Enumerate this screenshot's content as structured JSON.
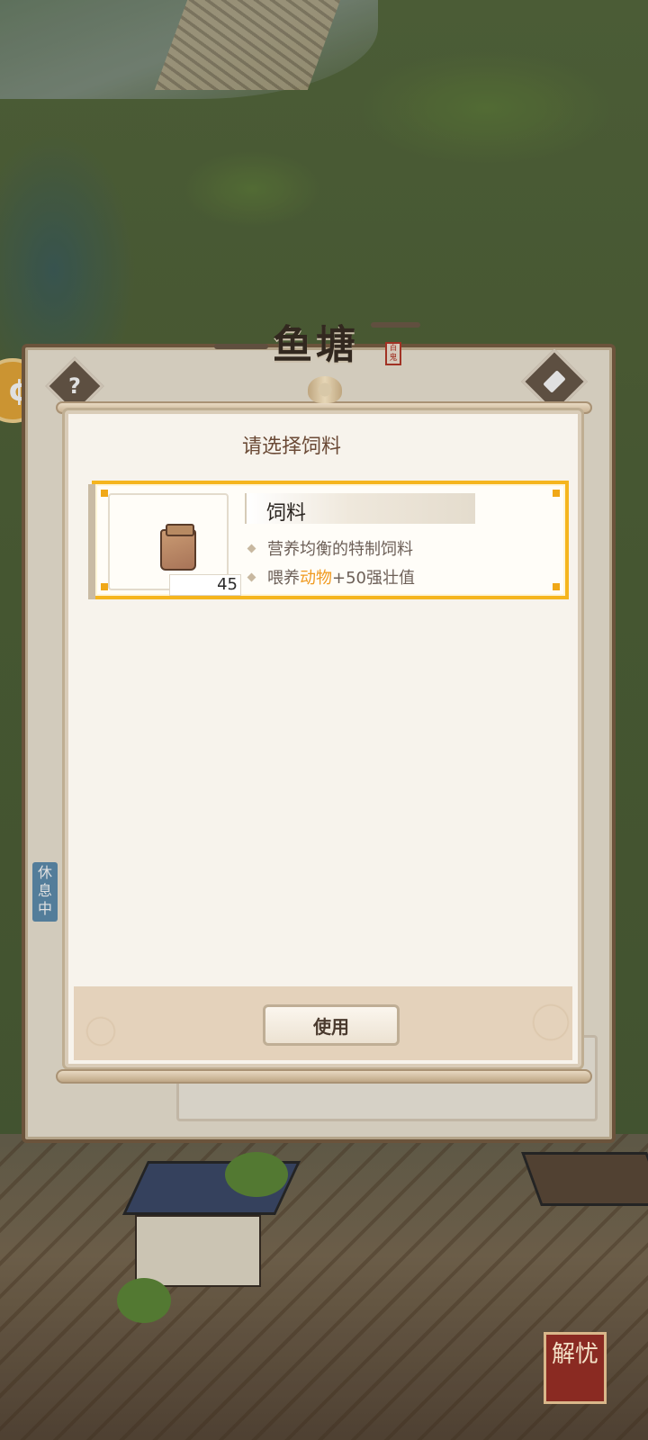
{
  "pond": {
    "title": "鱼塘",
    "seal": "百鬼",
    "help": "?",
    "resting": "休息中"
  },
  "modal": {
    "title": "请选择饲料",
    "item": {
      "name": "饲料",
      "quantity": "45",
      "desc1": "营养均衡的特制饲料",
      "desc2_prefix": "喂养",
      "desc2_highlight": "动物",
      "desc2_suffix": "+50强壮值"
    },
    "use_button": "使用"
  },
  "corner_badge": "解忧",
  "colors": {
    "highlight_border": "#f5b51e",
    "highlight_text": "#f09a20"
  },
  "icons": {
    "left_round": "coin-icon",
    "help": "question-icon",
    "build": "hammer-icon",
    "feed": "feed-bag-icon"
  }
}
